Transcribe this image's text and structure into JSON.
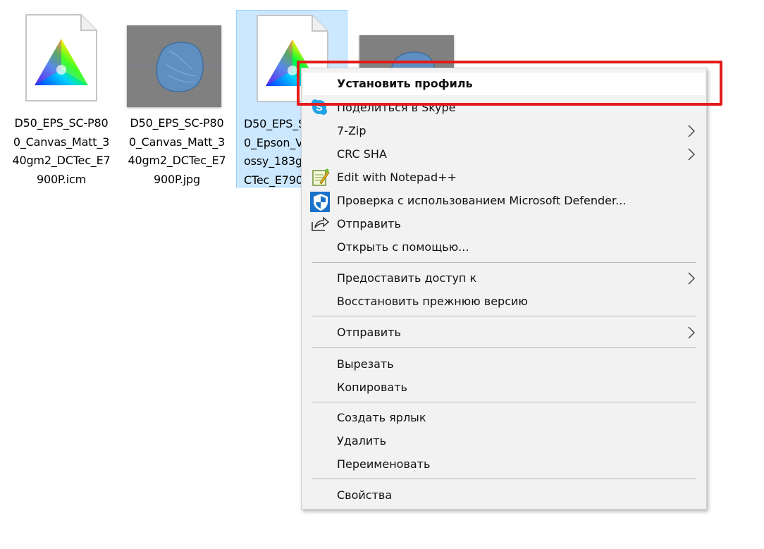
{
  "files": [
    {
      "name": "D50_EPS_SC-P80\n0_Canvas_Matt_3\n40gm2_DCTec_E7\n900P.icm",
      "icon": "color-profile-icon"
    },
    {
      "name": "D50_EPS_SC-P80\n0_Canvas_Matt_3\n40gm2_DCTec_E7\n900P.jpg",
      "icon": "image-thumbnail"
    },
    {
      "name": "D50_EPS_S\n0_Epson_V\nossy_183g\nCTec_E790",
      "icon": "color-profile-icon"
    },
    {
      "name": "",
      "icon": "image-thumbnail"
    }
  ],
  "menu": {
    "items": [
      {
        "label": "Установить профиль",
        "bold": true
      },
      {
        "label": "Поделиться в Skype",
        "icon": "skype-icon"
      },
      {
        "label": "7-Zip",
        "submenu": true
      },
      {
        "label": "CRC SHA",
        "submenu": true
      },
      {
        "label": "Edit with Notepad++",
        "icon": "notepad-plus-plus-icon"
      },
      {
        "label": "Проверка с использованием Microsoft Defender...",
        "icon": "defender-shield-icon"
      },
      {
        "label": "Отправить",
        "icon": "share-icon"
      },
      {
        "label": "Открыть с помощью..."
      },
      {
        "label": "Предоставить доступ к",
        "submenu": true
      },
      {
        "label": "Восстановить прежнюю версию"
      },
      {
        "label": "Отправить",
        "submenu": true
      },
      {
        "label": "Вырезать"
      },
      {
        "label": "Копировать"
      },
      {
        "label": "Создать ярлык"
      },
      {
        "label": "Удалить"
      },
      {
        "label": "Переименовать"
      },
      {
        "label": "Свойства"
      }
    ]
  },
  "colors": {
    "highlight_box": "#e31b1b",
    "selection": "#cce8ff",
    "menu_bg": "#f2f2f2"
  }
}
